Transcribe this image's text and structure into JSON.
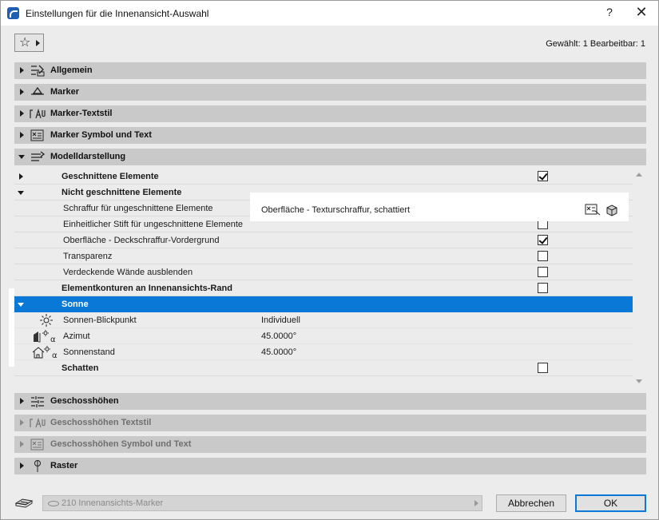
{
  "window": {
    "title": "Einstellungen für die Innenansicht-Auswahl",
    "help_label": "?",
    "close_label": "✕"
  },
  "toolbar": {
    "favorites_icon": "star-icon",
    "selection_info": "Gewählt: 1 Bearbeitbar: 1"
  },
  "panels_top": [
    {
      "label": "Allgemein",
      "icon": "general-settings-icon"
    },
    {
      "label": "Marker",
      "icon": "marker-icon"
    },
    {
      "label": "Marker-Textstil",
      "icon": "text-style-icon"
    },
    {
      "label": "Marker Symbol und Text",
      "icon": "symbol-text-icon"
    },
    {
      "label": "Modelldarstellung",
      "icon": "model-display-icon",
      "expanded": true
    }
  ],
  "tree": {
    "rows": [
      {
        "label": "Geschnittene Elemente",
        "group": true,
        "arrow": "right",
        "checked": true
      },
      {
        "label": "Nicht geschnittene Elemente",
        "group": true,
        "arrow": "down"
      },
      {
        "label": "Schraffur für ungeschnittene Elemente",
        "value": "Oberfläche - Texturschraffur, schattiert"
      },
      {
        "label": "Einheitlicher Stift für ungeschnittene Elemente",
        "checked": false
      },
      {
        "label": "Oberfläche - Deckschraffur-Vordergrund",
        "checked": true
      },
      {
        "label": "Transparenz",
        "checked": false
      },
      {
        "label": "Verdeckende Wände ausblenden",
        "checked": false
      },
      {
        "label": "Elementkonturen an Innenansichts-Rand",
        "checked": false
      },
      {
        "label": "Sonne",
        "group": true,
        "arrow": "down",
        "selected": true
      },
      {
        "label": "Sonnen-Blickpunkt",
        "value": "Individuell",
        "icon": "sun-icon"
      },
      {
        "label": "Azimut",
        "value": "45.0000°",
        "icon": "azimuth-icon"
      },
      {
        "label": "Sonnenstand",
        "value": "45.0000°",
        "icon": "sun-altitude-icon"
      },
      {
        "label": "Schatten",
        "group": true,
        "checked": false
      }
    ]
  },
  "panels_bottom": [
    {
      "label": "Geschosshöhen",
      "icon": "story-levels-icon",
      "disabled": false
    },
    {
      "label": "Geschosshöhen Textstil",
      "icon": "text-style-icon",
      "disabled": true
    },
    {
      "label": "Geschosshöhen Symbol und Text",
      "icon": "symbol-text-icon",
      "disabled": true
    },
    {
      "label": "Raster",
      "icon": "grid-icon",
      "disabled": false
    }
  ],
  "footer": {
    "marker_name": "210 Innenansichts-Marker",
    "cancel_label": "Abbrechen",
    "ok_label": "OK"
  },
  "colors": {
    "selection": "#0a78d7",
    "panel_header": "#c9c9c9",
    "background": "#ececec"
  }
}
